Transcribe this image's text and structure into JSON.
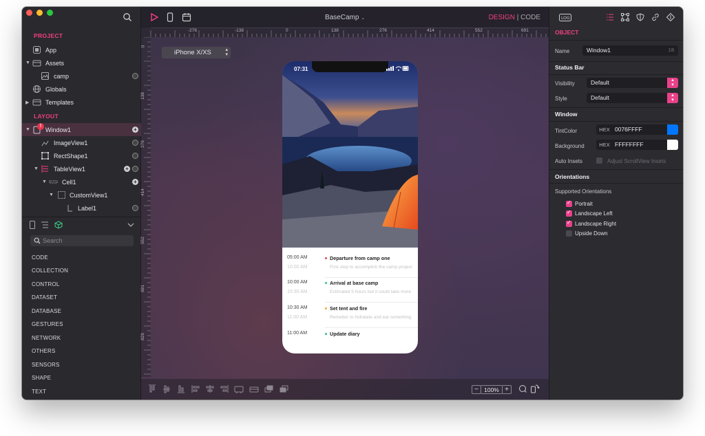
{
  "app": {
    "title": "BaseCamp",
    "mode_design": "DESIGN",
    "mode_sep": "|",
    "mode_code": "CODE"
  },
  "left": {
    "project_title": "PROJECT",
    "layout_title": "LAYOUT",
    "project_items": [
      "App",
      "Assets",
      "camp",
      "Globals",
      "Templates"
    ],
    "layout_items": [
      "Window1",
      "ImageView1",
      "RectShape1",
      "TableView1",
      "Cell1",
      "CustomView1",
      "Label1"
    ],
    "badge": "!",
    "search_placeholder": "Search",
    "library": [
      "CODE",
      "COLLECTION",
      "CONTROL",
      "DATASET",
      "DATABASE",
      "GESTURES",
      "NETWORK",
      "OTHERS",
      "SENSORS",
      "SHAPE",
      "TEXT"
    ]
  },
  "canvas": {
    "device": "iPhone X/XS",
    "rulers_h": [
      "-276",
      "-138",
      "0",
      "138",
      "276",
      "414",
      "552",
      "691"
    ],
    "rulers_v": [
      "0",
      "138",
      "276",
      "414",
      "552",
      "691",
      "829"
    ],
    "zoom": "100%",
    "zoom_minus": "−",
    "zoom_plus": "+"
  },
  "phone": {
    "time": "07:31",
    "rows": [
      {
        "time": "05:00 AM",
        "time2": "10:00 AM",
        "title": "Departure from camp one",
        "sub": "First step to accomplish the camp project",
        "dot": "#e5475a"
      },
      {
        "time": "10:00 AM",
        "time2": "10:30 AM",
        "title": "Arrival at base camp",
        "sub": "Estimated 5 hours but it could take more",
        "dot": "#2fbf9a"
      },
      {
        "time": "10:30 AM",
        "time2": "11:00 AM",
        "title": "Set tent and fire",
        "sub": "Remeber to hidratate and eat something",
        "dot": "#f0a830"
      },
      {
        "time": "11:00 AM",
        "time2": "",
        "title": "Update diary",
        "sub": "",
        "dot": "#2fbf9a"
      }
    ]
  },
  "inspector": {
    "object_title": "OBJECT",
    "name_label": "Name",
    "name_value": "Window1",
    "name_count": "18",
    "statusbar_title": "Status Bar",
    "visibility_label": "Visibility",
    "visibility_value": "Default",
    "style_label": "Style",
    "style_value": "Default",
    "window_title": "Window",
    "tint_label": "TintColor",
    "hex_tag": "HEX",
    "tint_value": "0076FFFF",
    "tint_color": "#0076ff",
    "bg_label": "Background",
    "bg_value": "FFFFFFFF",
    "bg_color": "#ffffff",
    "autoinsets_label": "Auto Insets",
    "autoinsets_text": "Adjust ScrollView Insets",
    "orient_title": "Orientations",
    "supported_label": "Supported Orientations",
    "orientations": [
      {
        "label": "Portrait",
        "checked": true
      },
      {
        "label": "Landscape Left",
        "checked": true
      },
      {
        "label": "Landscape Right",
        "checked": true
      },
      {
        "label": "Upside Down",
        "checked": false
      }
    ]
  },
  "colors": {
    "accent": "#f0407e",
    "panel": "#2a292e"
  }
}
